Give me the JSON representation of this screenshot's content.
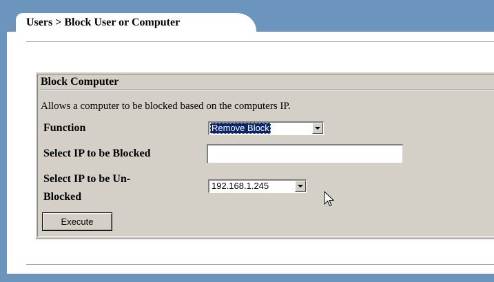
{
  "tab": {
    "label": "Users > Block User or Computer"
  },
  "panel": {
    "title": "Block Computer",
    "description": "Allows a computer to be blocked based on the computers IP."
  },
  "form": {
    "function_label": "Function",
    "function_value": "Remove Block",
    "block_ip_label": "Select IP to be Blocked",
    "block_ip_value": "",
    "unblock_ip_label_line1": "Select IP to be Un-",
    "unblock_ip_label_line2": "Blocked",
    "unblock_ip_value": "192.168.1.245",
    "execute_label": "Execute"
  },
  "icons": {
    "dropdown": "chevron-down-icon",
    "cursor": "mouse-pointer-icon"
  },
  "colors": {
    "frame": "#6b95bd",
    "panel": "#d4d0c8",
    "selection": "#0a246a"
  }
}
